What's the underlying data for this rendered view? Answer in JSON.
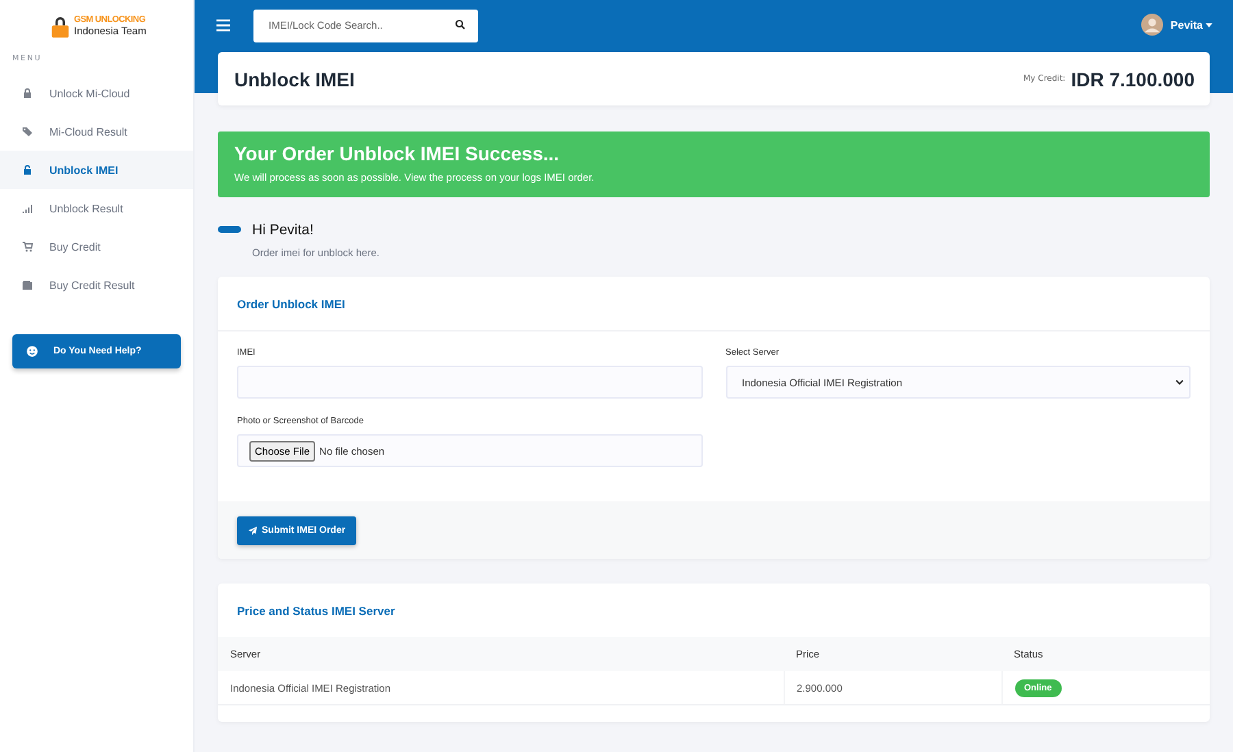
{
  "brand": {
    "line1": "GSM UNLOCKING",
    "line2": "Indonesia Team"
  },
  "sidebar": {
    "heading": "MENU",
    "items": [
      {
        "label": "Unlock Mi-Cloud",
        "selected": false
      },
      {
        "label": "Mi-Cloud Result",
        "selected": false
      },
      {
        "label": "Unblock IMEI",
        "selected": true
      },
      {
        "label": "Unblock Result",
        "selected": false
      },
      {
        "label": "Buy Credit",
        "selected": false
      },
      {
        "label": "Buy Credit Result",
        "selected": false
      }
    ],
    "help_button": "Do You Need Help?"
  },
  "topbar": {
    "search": {
      "placeholder": "IMEI/Lock Code Search.."
    },
    "user": "Pevita"
  },
  "header": {
    "title": "Unblock IMEI",
    "credit_label": "My Credit:",
    "credit": "IDR 7.100.000"
  },
  "alert": {
    "title": "Your Order Unblock IMEI Success...",
    "text": "We will process as soon as possible. View the process on your logs IMEI order."
  },
  "greeting": {
    "title": "Hi Pevita!",
    "subtitle": "Order imei for unblock here."
  },
  "order_form": {
    "title": "Order Unblock IMEI",
    "imei_label": "IMEI",
    "server_label": "Select Server",
    "server_value": "Indonesia Official IMEI Registration",
    "file_label": "Photo or Screenshot of Barcode",
    "file_button": "Choose File",
    "file_status": "No file chosen",
    "submit": "Submit IMEI Order"
  },
  "price_table": {
    "title": "Price and Status IMEI Server",
    "columns": [
      "Server",
      "Price",
      "Status"
    ],
    "rows": [
      {
        "server": "Indonesia Official IMEI Registration",
        "price": "2.900.000",
        "status": "Online",
        "online": true
      }
    ]
  }
}
